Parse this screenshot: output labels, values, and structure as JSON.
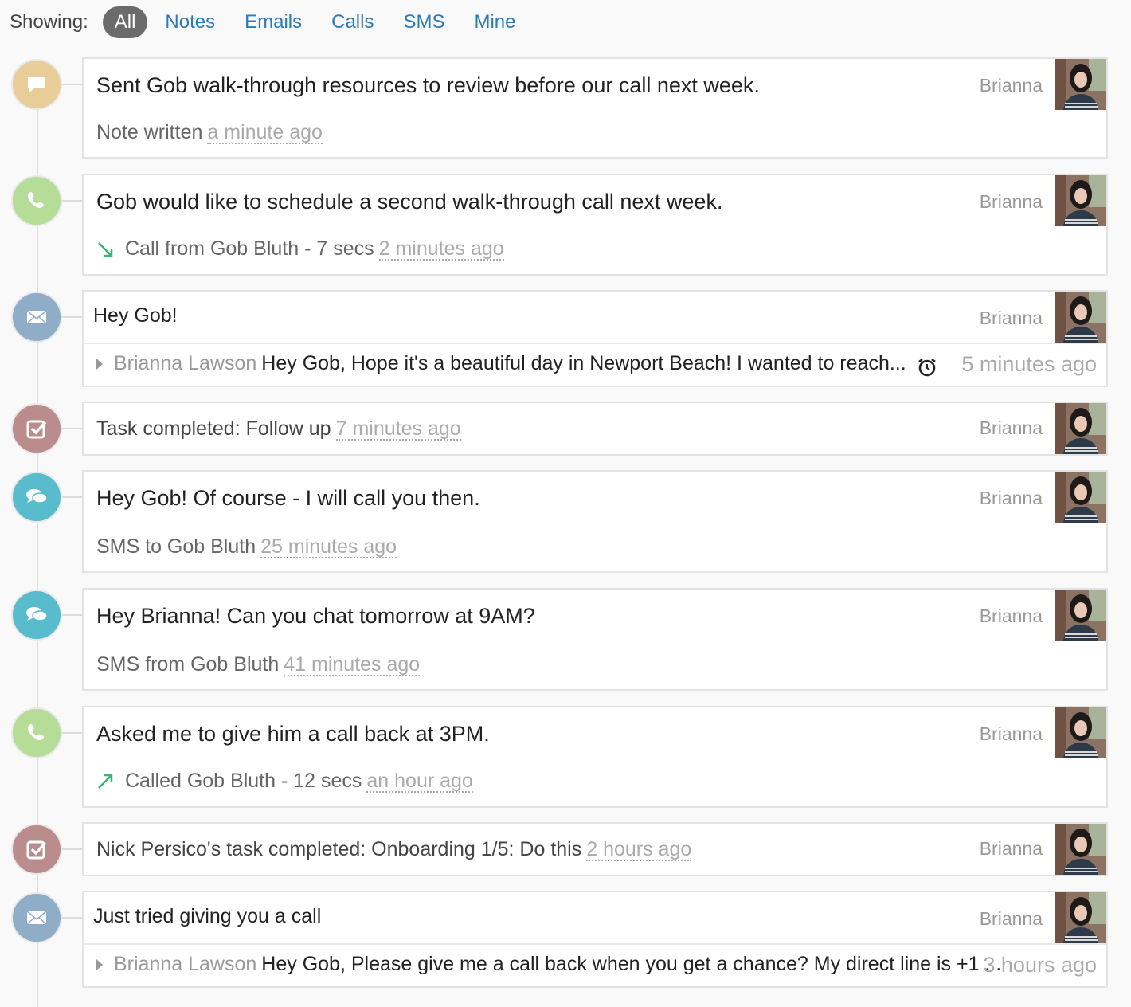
{
  "filters": {
    "label": "Showing:",
    "options": [
      "All",
      "Notes",
      "Emails",
      "Calls",
      "SMS",
      "Mine"
    ],
    "active": "All"
  },
  "colors": {
    "note": "#e8cd99",
    "call": "#b6dd98",
    "email": "#8fadc6",
    "task": "#bb8c8c",
    "sms": "#58bccd",
    "link": "#2b7bb9",
    "call_arrow": "#3cb371"
  },
  "activities": [
    {
      "type": "note",
      "icon": "note-icon",
      "text": "Sent Gob walk-through resources to review before our call next week.",
      "meta": "Note written",
      "time": "a minute ago",
      "owner": "Brianna"
    },
    {
      "type": "call",
      "icon": "phone-icon",
      "text": "Gob would like to schedule a second walk-through call next week.",
      "direction": "incoming",
      "meta": "Call from Gob Bluth - 7 secs",
      "time": "2 minutes ago",
      "owner": "Brianna"
    },
    {
      "type": "email",
      "icon": "envelope-icon",
      "subject": "Hey Gob!",
      "sender": "Brianna Lawson",
      "snippet": "Hey Gob, Hope it's a beautiful day in Newport Beach! I wanted to reach...",
      "time": "5 minutes ago",
      "owner": "Brianna",
      "reminder": "alarm-clock-icon"
    },
    {
      "type": "task",
      "icon": "check-square-icon",
      "meta": "Task completed: Follow up",
      "time": "7 minutes ago",
      "owner": "Brianna"
    },
    {
      "type": "sms",
      "icon": "chat-bubbles-icon",
      "text": "Hey Gob! Of course - I will call you then.",
      "meta": "SMS to Gob Bluth",
      "time": "25 minutes ago",
      "owner": "Brianna"
    },
    {
      "type": "sms",
      "icon": "chat-bubbles-icon",
      "text": "Hey Brianna! Can you chat tomorrow at 9AM?",
      "meta": "SMS from Gob Bluth",
      "time": "41 minutes ago",
      "owner": "Brianna"
    },
    {
      "type": "call",
      "icon": "phone-icon",
      "text": "Asked me to give him a call back at 3PM.",
      "direction": "outgoing",
      "meta": "Called Gob Bluth - 12 secs",
      "time": "an hour ago",
      "owner": "Brianna"
    },
    {
      "type": "task",
      "icon": "check-square-icon",
      "meta": "Nick Persico's task completed: Onboarding 1/5: Do this",
      "time": "2 hours ago",
      "owner": "Brianna"
    },
    {
      "type": "email",
      "icon": "envelope-icon",
      "subject": "Just tried giving you a call",
      "sender": "Brianna Lawson",
      "snippet": "Hey Gob, Please give me a call back when you get a chance? My direct line is +1 ...",
      "time": "3 hours ago",
      "owner": "Brianna"
    }
  ]
}
